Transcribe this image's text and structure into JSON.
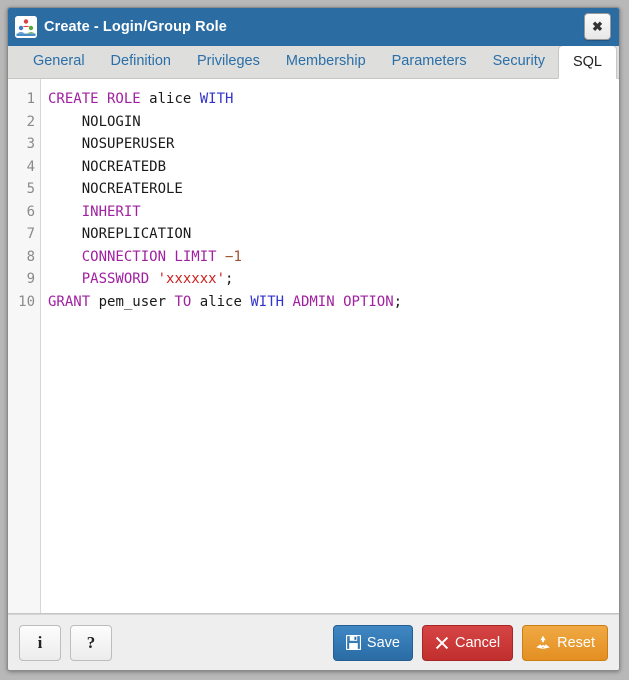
{
  "window": {
    "title": "Create - Login/Group Role",
    "icon": "group-role-icon",
    "close_label": "✖",
    "titlebar_color": "#2b6ca3"
  },
  "tabs": [
    {
      "label": "General",
      "active": false
    },
    {
      "label": "Definition",
      "active": false
    },
    {
      "label": "Privileges",
      "active": false
    },
    {
      "label": "Membership",
      "active": false
    },
    {
      "label": "Parameters",
      "active": false
    },
    {
      "label": "Security",
      "active": false
    },
    {
      "label": "SQL",
      "active": true
    }
  ],
  "editor": {
    "line_numbers": [
      "1",
      "2",
      "3",
      "4",
      "5",
      "6",
      "7",
      "8",
      "9",
      "10"
    ],
    "lines": [
      {
        "n": "1",
        "text": "CREATE ROLE alice WITH"
      },
      {
        "n": "2",
        "text": "    NOLOGIN"
      },
      {
        "n": "3",
        "text": "    NOSUPERUSER"
      },
      {
        "n": "4",
        "text": "    NOCREATEDB"
      },
      {
        "n": "5",
        "text": "    NOCREATEROLE"
      },
      {
        "n": "6",
        "text": "    INHERIT"
      },
      {
        "n": "7",
        "text": "    NOREPLICATION"
      },
      {
        "n": "8",
        "text": "    CONNECTION LIMIT −1"
      },
      {
        "n": "9",
        "text": "    PASSWORD 'xxxxxx';"
      },
      {
        "n": "10",
        "text": "GRANT pem_user TO alice WITH ADMIN OPTION;"
      }
    ],
    "tokens": [
      [
        {
          "t": "CREATE ROLE",
          "c": "kw"
        },
        {
          "t": " ",
          "c": "punct"
        },
        {
          "t": "alice",
          "c": "ident"
        },
        {
          "t": " ",
          "c": "punct"
        },
        {
          "t": "WITH",
          "c": "kw2"
        }
      ],
      [
        {
          "t": "    ",
          "c": "punct"
        },
        {
          "t": "NOLOGIN",
          "c": "ident"
        }
      ],
      [
        {
          "t": "    ",
          "c": "punct"
        },
        {
          "t": "NOSUPERUSER",
          "c": "ident"
        }
      ],
      [
        {
          "t": "    ",
          "c": "punct"
        },
        {
          "t": "NOCREATEDB",
          "c": "ident"
        }
      ],
      [
        {
          "t": "    ",
          "c": "punct"
        },
        {
          "t": "NOCREATEROLE",
          "c": "ident"
        }
      ],
      [
        {
          "t": "    ",
          "c": "punct"
        },
        {
          "t": "INHERIT",
          "c": "kw"
        }
      ],
      [
        {
          "t": "    ",
          "c": "punct"
        },
        {
          "t": "NOREPLICATION",
          "c": "ident"
        }
      ],
      [
        {
          "t": "    ",
          "c": "punct"
        },
        {
          "t": "CONNECTION LIMIT",
          "c": "kw"
        },
        {
          "t": " ",
          "c": "punct"
        },
        {
          "t": "−1",
          "c": "num"
        }
      ],
      [
        {
          "t": "    ",
          "c": "punct"
        },
        {
          "t": "PASSWORD",
          "c": "kw"
        },
        {
          "t": " ",
          "c": "punct"
        },
        {
          "t": "'xxxxxx'",
          "c": "str"
        },
        {
          "t": ";",
          "c": "punct"
        }
      ],
      [
        {
          "t": "GRANT",
          "c": "kw"
        },
        {
          "t": " ",
          "c": "punct"
        },
        {
          "t": "pem_user",
          "c": "ident"
        },
        {
          "t": " ",
          "c": "punct"
        },
        {
          "t": "TO",
          "c": "kw"
        },
        {
          "t": " ",
          "c": "punct"
        },
        {
          "t": "alice",
          "c": "ident"
        },
        {
          "t": " ",
          "c": "punct"
        },
        {
          "t": "WITH",
          "c": "kw2"
        },
        {
          "t": " ",
          "c": "punct"
        },
        {
          "t": "ADMIN OPTION",
          "c": "kw"
        },
        {
          "t": ";",
          "c": "punct"
        }
      ]
    ],
    "syntax_colors": {
      "keyword": "#a020a0",
      "keyword_alt": "#3333cc",
      "identifier": "#1a1a1a",
      "string": "#cc2222",
      "number": "#a0522d",
      "gutter_text": "#8a8a8a"
    }
  },
  "footer": {
    "info_label": "i",
    "help_label": "?",
    "save_label": "Save",
    "cancel_label": "Cancel",
    "reset_label": "Reset",
    "save_color": "#2a6ca4",
    "cancel_color": "#c12e2e",
    "reset_color": "#e38f22"
  }
}
